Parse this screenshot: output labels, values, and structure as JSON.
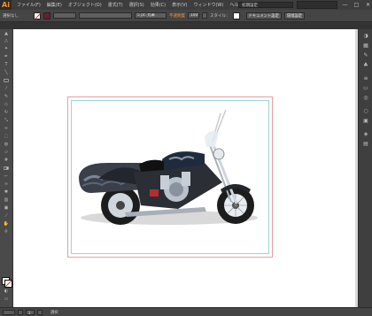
{
  "app": {
    "logo": "Ai"
  },
  "menu": {
    "items": [
      "ファイル(F)",
      "編集(E)",
      "オブジェクト(O)",
      "書式(T)",
      "選択(S)",
      "効果(C)",
      "表示(V)",
      "ウィンドウ(W)",
      "ヘルプ(H)"
    ]
  },
  "workspace": {
    "label": "初期設定"
  },
  "window_buttons": {
    "minimize": "—",
    "maximize": "□",
    "close": "✕"
  },
  "control_bar": {
    "selection_label": "選択なし",
    "stroke_weight": "5 pt. 丸筆",
    "opacity_label": "不透明度",
    "opacity_value": "100%",
    "style_label": "スタイル：",
    "document_setup": "ドキュメント設定",
    "preferences": "環境設定"
  },
  "status_bar": {
    "zoom": "",
    "artboard": "1",
    "tool_label": "選択"
  },
  "icons": [
    "selection-tool-icon",
    "direct-selection-tool-icon",
    "magic-wand-icon",
    "lasso-icon",
    "pen-icon",
    "type-icon",
    "line-icon",
    "rectangle-icon",
    "paintbrush-icon",
    "pencil-icon",
    "eraser-icon",
    "rotate-icon",
    "scale-icon",
    "width-icon",
    "free-transform-icon",
    "shape-builder-icon",
    "perspective-icon",
    "mesh-icon",
    "gradient-icon",
    "eyedropper-icon",
    "blend-icon",
    "symbol-sprayer-icon",
    "graph-icon",
    "artboard-tool-icon",
    "slice-icon",
    "hand-icon",
    "zoom-icon"
  ]
}
